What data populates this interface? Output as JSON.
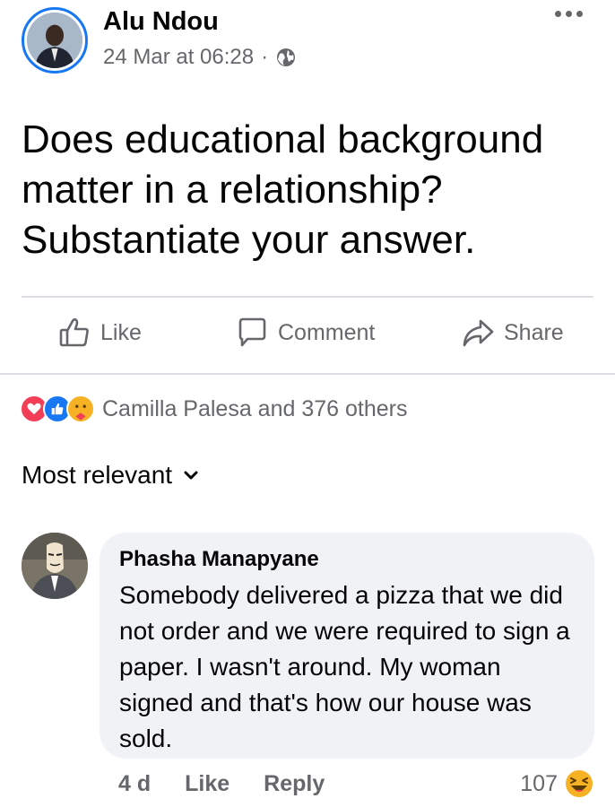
{
  "post": {
    "author": "Alu Ndou",
    "time": "24 Mar at 06:28",
    "separator": "·",
    "text": "Does educational background matter in a relationship? Substantiate your answer."
  },
  "actions": {
    "like": "Like",
    "comment": "Comment",
    "share": "Share"
  },
  "reactions": {
    "summary": "Camilla Palesa and 376 others",
    "types": [
      "love-icon",
      "like-icon",
      "care-icon"
    ]
  },
  "sort": {
    "label": "Most relevant"
  },
  "comment": {
    "author": "Phasha Manapyane",
    "text": "Somebody delivered a pizza that we did not order and we were required to sign a paper. I wasn't around. My woman signed and that's how our house was sold.",
    "time": "4 d",
    "like_label": "Like",
    "reply_label": "Reply",
    "reaction_count": "107",
    "reaction_icon": "haha-icon"
  },
  "colors": {
    "accent": "#1877f2",
    "secondary_text": "#65676b",
    "bubble_bg": "#f0f2f5"
  }
}
